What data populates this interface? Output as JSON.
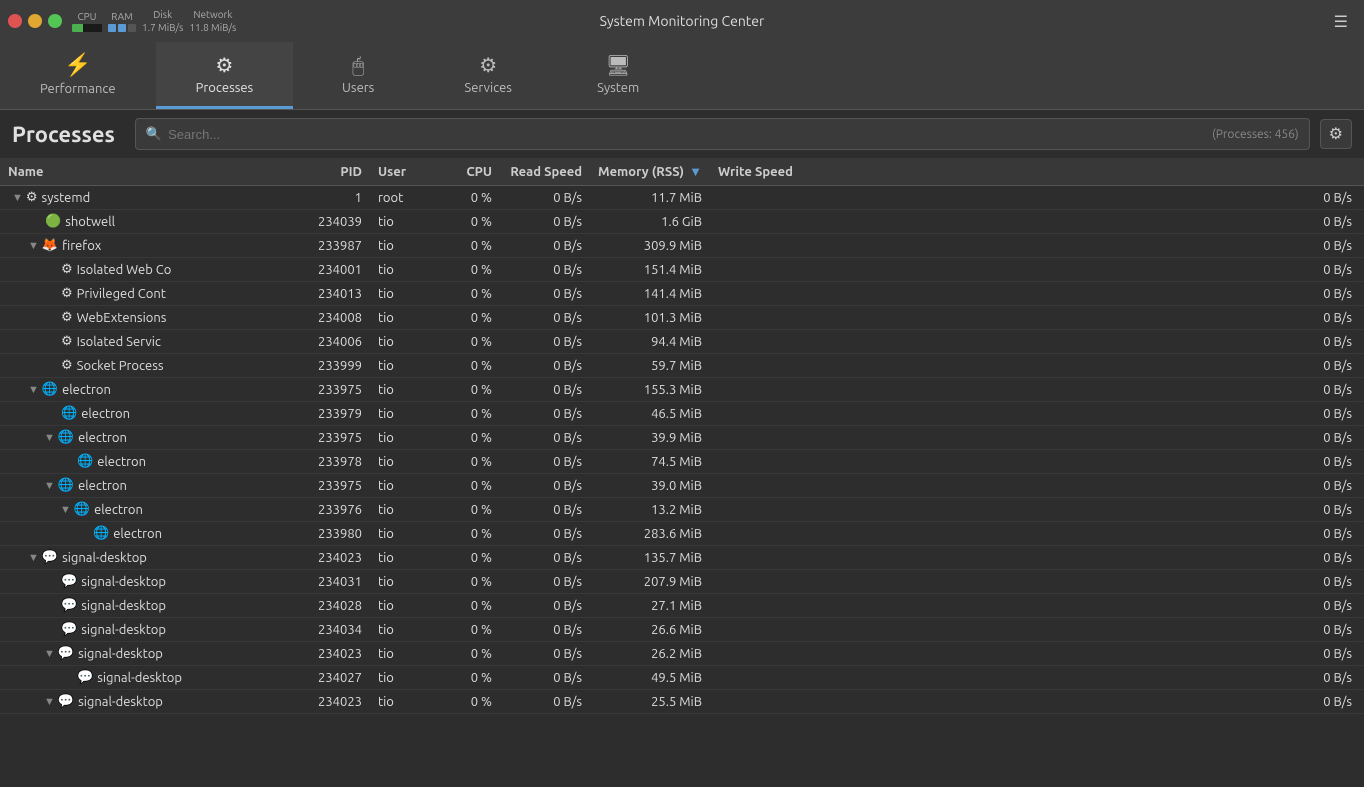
{
  "titlebar": {
    "title": "System Monitoring Center",
    "cpu_label": "CPU",
    "ram_label": "RAM",
    "disk_label": "Disk",
    "network_label": "Network",
    "disk_speed": "1.7 MiB/s",
    "network_speed": "11.8 MiB/s"
  },
  "nav": {
    "tabs": [
      {
        "id": "performance",
        "label": "Performance",
        "icon": "⚡"
      },
      {
        "id": "processes",
        "label": "Processes",
        "icon": "⚙"
      },
      {
        "id": "users",
        "label": "Users",
        "icon": "🖱"
      },
      {
        "id": "services",
        "label": "Services",
        "icon": "⚙"
      },
      {
        "id": "system",
        "label": "System",
        "icon": "🖥"
      }
    ],
    "active": "processes"
  },
  "page": {
    "title": "Processes",
    "search_placeholder": "Search...",
    "process_count": "(Processes: 456)"
  },
  "table": {
    "columns": [
      "Name",
      "PID",
      "User",
      "CPU",
      "Read Speed",
      "Memory (RSS)",
      "Write Speed"
    ],
    "sort_col": "Memory (RSS)",
    "rows": [
      {
        "indent": 0,
        "toggle": "▼",
        "icon": "⚙",
        "icon_color": "#888",
        "name": "systemd",
        "pid": "1",
        "user": "root",
        "cpu": "0 %",
        "read": "0 B/s",
        "mem": "11.7 MiB",
        "write": "0 B/s"
      },
      {
        "indent": 1,
        "toggle": "",
        "icon": "🟢",
        "icon_color": "#4caf50",
        "name": "shotwell",
        "pid": "234039",
        "user": "tio",
        "cpu": "0 %",
        "read": "0 B/s",
        "mem": "1.6 GiB",
        "write": "0 B/s"
      },
      {
        "indent": 1,
        "toggle": "▼",
        "icon": "🦊",
        "icon_color": "#e55",
        "name": "firefox",
        "pid": "233987",
        "user": "tio",
        "cpu": "0 %",
        "read": "0 B/s",
        "mem": "309.9 MiB",
        "write": "0 B/s"
      },
      {
        "indent": 2,
        "toggle": "",
        "icon": "⚙",
        "icon_color": "#888",
        "name": "Isolated Web Co",
        "pid": "234001",
        "user": "tio",
        "cpu": "0 %",
        "read": "0 B/s",
        "mem": "151.4 MiB",
        "write": "0 B/s"
      },
      {
        "indent": 2,
        "toggle": "",
        "icon": "⚙",
        "icon_color": "#888",
        "name": "Privileged Cont",
        "pid": "234013",
        "user": "tio",
        "cpu": "0 %",
        "read": "0 B/s",
        "mem": "141.4 MiB",
        "write": "0 B/s"
      },
      {
        "indent": 2,
        "toggle": "",
        "icon": "⚙",
        "icon_color": "#888",
        "name": "WebExtensions",
        "pid": "234008",
        "user": "tio",
        "cpu": "0 %",
        "read": "0 B/s",
        "mem": "101.3 MiB",
        "write": "0 B/s"
      },
      {
        "indent": 2,
        "toggle": "",
        "icon": "⚙",
        "icon_color": "#888",
        "name": "Isolated Servic",
        "pid": "234006",
        "user": "tio",
        "cpu": "0 %",
        "read": "0 B/s",
        "mem": "94.4 MiB",
        "write": "0 B/s"
      },
      {
        "indent": 2,
        "toggle": "",
        "icon": "⚙",
        "icon_color": "#888",
        "name": "Socket Process",
        "pid": "233999",
        "user": "tio",
        "cpu": "0 %",
        "read": "0 B/s",
        "mem": "59.7 MiB",
        "write": "0 B/s"
      },
      {
        "indent": 1,
        "toggle": "▼",
        "icon": "🌐",
        "icon_color": "#5b9bd5",
        "name": "electron",
        "pid": "233975",
        "user": "tio",
        "cpu": "0 %",
        "read": "0 B/s",
        "mem": "155.3 MiB",
        "write": "0 B/s"
      },
      {
        "indent": 2,
        "toggle": "",
        "icon": "🌐",
        "icon_color": "#5b9bd5",
        "name": "electron",
        "pid": "233979",
        "user": "tio",
        "cpu": "0 %",
        "read": "0 B/s",
        "mem": "46.5 MiB",
        "write": "0 B/s"
      },
      {
        "indent": 2,
        "toggle": "▼",
        "icon": "🌐",
        "icon_color": "#5b9bd5",
        "name": "electron",
        "pid": "233975",
        "user": "tio",
        "cpu": "0 %",
        "read": "0 B/s",
        "mem": "39.9 MiB",
        "write": "0 B/s"
      },
      {
        "indent": 3,
        "toggle": "",
        "icon": "🌐",
        "icon_color": "#5b9bd5",
        "name": "electron",
        "pid": "233978",
        "user": "tio",
        "cpu": "0 %",
        "read": "0 B/s",
        "mem": "74.5 MiB",
        "write": "0 B/s"
      },
      {
        "indent": 2,
        "toggle": "▼",
        "icon": "🌐",
        "icon_color": "#5b9bd5",
        "name": "electron",
        "pid": "233975",
        "user": "tio",
        "cpu": "0 %",
        "read": "0 B/s",
        "mem": "39.0 MiB",
        "write": "0 B/s"
      },
      {
        "indent": 3,
        "toggle": "▼",
        "icon": "🌐",
        "icon_color": "#5b9bd5",
        "name": "electron",
        "pid": "233976",
        "user": "tio",
        "cpu": "0 %",
        "read": "0 B/s",
        "mem": "13.2 MiB",
        "write": "0 B/s"
      },
      {
        "indent": 4,
        "toggle": "",
        "icon": "🌐",
        "icon_color": "#5b9bd5",
        "name": "electron",
        "pid": "233980",
        "user": "tio",
        "cpu": "0 %",
        "read": "0 B/s",
        "mem": "283.6 MiB",
        "write": "0 B/s"
      },
      {
        "indent": 1,
        "toggle": "▼",
        "icon": "💬",
        "icon_color": "#5b9bd5",
        "name": "signal-desktop",
        "pid": "234023",
        "user": "tio",
        "cpu": "0 %",
        "read": "0 B/s",
        "mem": "135.7 MiB",
        "write": "0 B/s"
      },
      {
        "indent": 2,
        "toggle": "",
        "icon": "💬",
        "icon_color": "#5b9bd5",
        "name": "signal-desktop",
        "pid": "234031",
        "user": "tio",
        "cpu": "0 %",
        "read": "0 B/s",
        "mem": "207.9 MiB",
        "write": "0 B/s"
      },
      {
        "indent": 2,
        "toggle": "",
        "icon": "💬",
        "icon_color": "#5b9bd5",
        "name": "signal-desktop",
        "pid": "234028",
        "user": "tio",
        "cpu": "0 %",
        "read": "0 B/s",
        "mem": "27.1 MiB",
        "write": "0 B/s"
      },
      {
        "indent": 2,
        "toggle": "",
        "icon": "💬",
        "icon_color": "#5b9bd5",
        "name": "signal-desktop",
        "pid": "234034",
        "user": "tio",
        "cpu": "0 %",
        "read": "0 B/s",
        "mem": "26.6 MiB",
        "write": "0 B/s"
      },
      {
        "indent": 2,
        "toggle": "▼",
        "icon": "💬",
        "icon_color": "#5b9bd5",
        "name": "signal-desktop",
        "pid": "234023",
        "user": "tio",
        "cpu": "0 %",
        "read": "0 B/s",
        "mem": "26.2 MiB",
        "write": "0 B/s"
      },
      {
        "indent": 3,
        "toggle": "",
        "icon": "💬",
        "icon_color": "#5b9bd5",
        "name": "signal-desktop",
        "pid": "234027",
        "user": "tio",
        "cpu": "0 %",
        "read": "0 B/s",
        "mem": "49.5 MiB",
        "write": "0 B/s"
      },
      {
        "indent": 2,
        "toggle": "▼",
        "icon": "💬",
        "icon_color": "#5b9bd5",
        "name": "signal-desktop",
        "pid": "234023",
        "user": "tio",
        "cpu": "0 %",
        "read": "0 B/s",
        "mem": "25.5 MiB",
        "write": "0 B/s"
      }
    ]
  }
}
